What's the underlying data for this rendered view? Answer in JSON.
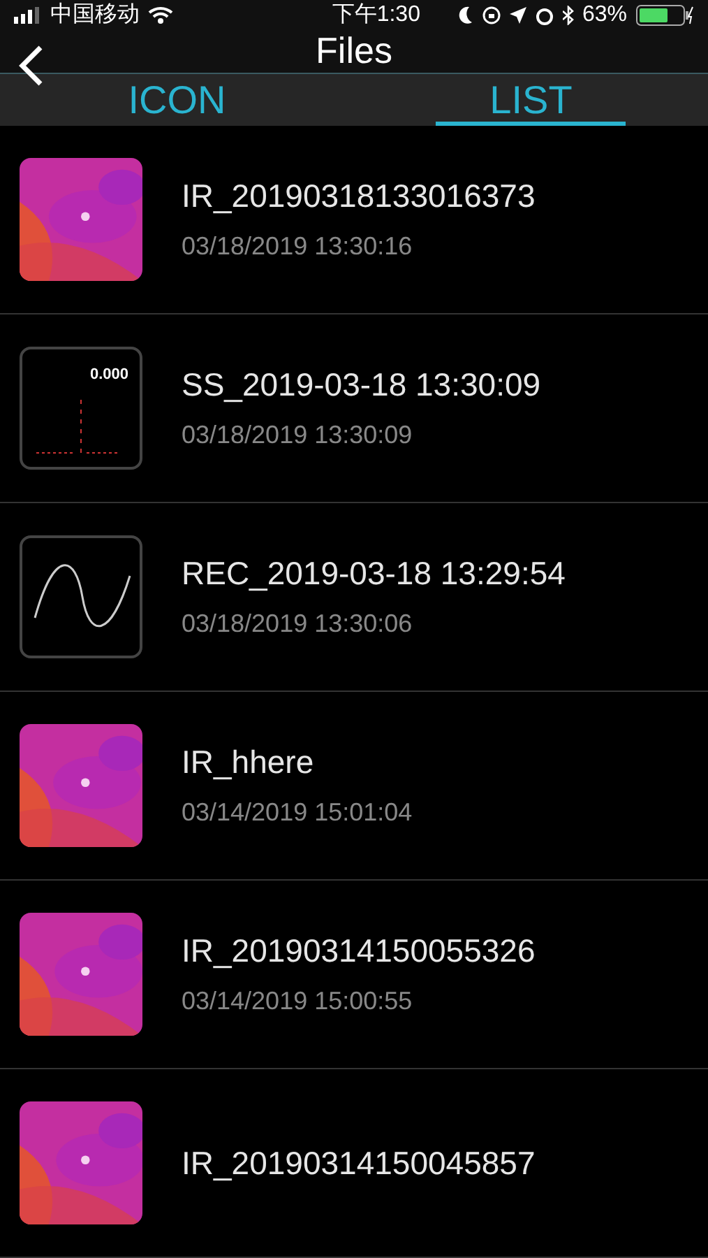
{
  "status_bar": {
    "carrier": "中国移动",
    "time": "下午1:30",
    "battery": "63%"
  },
  "nav": {
    "title": "Files"
  },
  "tabs": [
    {
      "label": "ICON",
      "selected": false
    },
    {
      "label": "LIST",
      "selected": true
    }
  ],
  "files": [
    {
      "kind": "thermal",
      "name": "IR_20190318133016373",
      "date": "03/18/2019 13:30:16"
    },
    {
      "kind": "screen",
      "reading": "0.000",
      "name": "SS_2019-03-18 13:30:09",
      "date": "03/18/2019 13:30:09"
    },
    {
      "kind": "wave",
      "name": "REC_2019-03-18 13:29:54",
      "date": "03/18/2019 13:30:06"
    },
    {
      "kind": "thermal",
      "name": "IR_hhere",
      "date": "03/14/2019 15:01:04"
    },
    {
      "kind": "thermal",
      "name": "IR_20190314150055326",
      "date": "03/14/2019 15:00:55"
    },
    {
      "kind": "thermal",
      "name": "IR_20190314150045857"
    }
  ]
}
